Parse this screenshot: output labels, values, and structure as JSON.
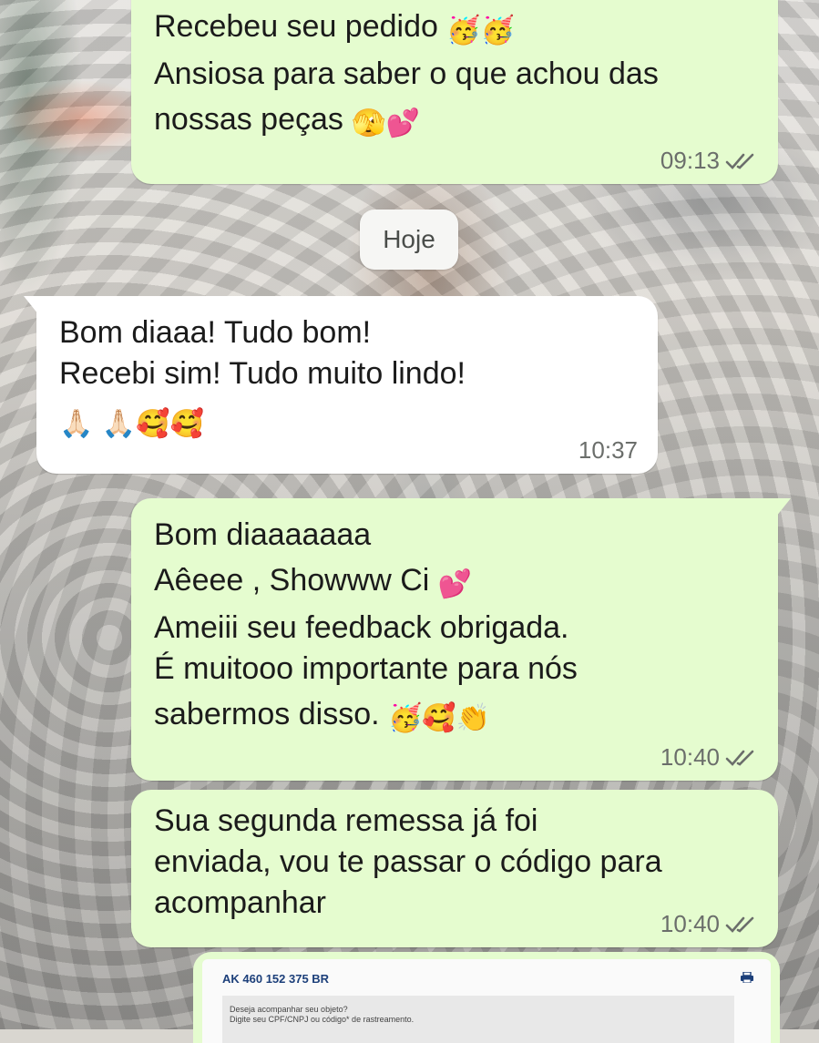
{
  "chat": {
    "messages": [
      {
        "direction": "outgoing",
        "lines": [
          "Recebeu seu pedido",
          "Ansiosa para saber o que achou das",
          "nossas peças"
        ],
        "time": "09:13",
        "status": "read"
      },
      {
        "direction": "incoming",
        "lines": [
          "Bom diaaa! Tudo bom!",
          "Recebi sim! Tudo muito lindo!"
        ],
        "time": "10:37"
      },
      {
        "direction": "outgoing",
        "lines": [
          "Bom diaaaaaaa",
          "Aêeee , Showww Ci",
          "Ameiii seu feedback obrigada.",
          "É muitooo importante para nós",
          "sabermos disso."
        ],
        "time": "10:40",
        "status": "read"
      },
      {
        "direction": "outgoing",
        "lines": [
          "Sua segunda remessa já foi",
          "enviada, vou te passar o código para",
          "acompanhar"
        ],
        "time": "10:40",
        "status": "read"
      }
    ],
    "date_separator": "Hoje",
    "attachment": {
      "tracking_code": "AK 460 152 375 BR",
      "text_line_1": "Deseja acompanhar seu objeto?",
      "text_line_2": "Digite seu CPF/CNPJ ou código* de rastreamento."
    }
  },
  "emojis": {
    "party_face": "🥳",
    "peeking_face": "🫣",
    "two_hearts": "💕",
    "folded_hands": "🙏🏻",
    "smiling_hearts": "🥰",
    "clapping_hands": "👏"
  },
  "colors": {
    "outgoing_bubble": "#e5fccf",
    "incoming_bubble": "#ffffff",
    "read_ticks": "#6b6e6b",
    "tracking_code": "#1c3f7a"
  },
  "icons": [
    "double-check-icon",
    "printer-icon"
  ]
}
